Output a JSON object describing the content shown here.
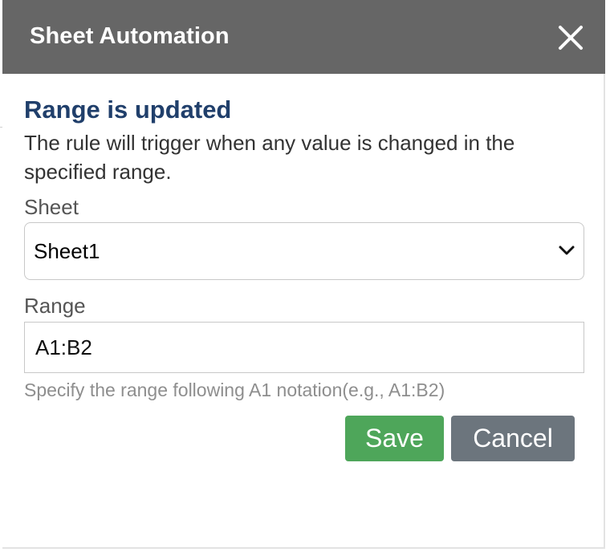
{
  "dialog": {
    "title": "Sheet Automation",
    "close_icon": "close-icon"
  },
  "content": {
    "heading": "Range is updated",
    "description": "The rule will trigger when any value is changed in the specified range."
  },
  "sheet_field": {
    "label": "Sheet",
    "selected_value": "Sheet1",
    "icon": "chevron-down-icon"
  },
  "range_field": {
    "label": "Range",
    "value": "A1:B2",
    "hint": "Specify the range following A1 notation(e.g., A1:B2)"
  },
  "actions": {
    "save_label": "Save",
    "cancel_label": "Cancel"
  },
  "colors": {
    "titlebar": "#666666",
    "heading": "#203f6b",
    "save_button": "#4ea65a",
    "cancel_button": "#6c757d"
  }
}
